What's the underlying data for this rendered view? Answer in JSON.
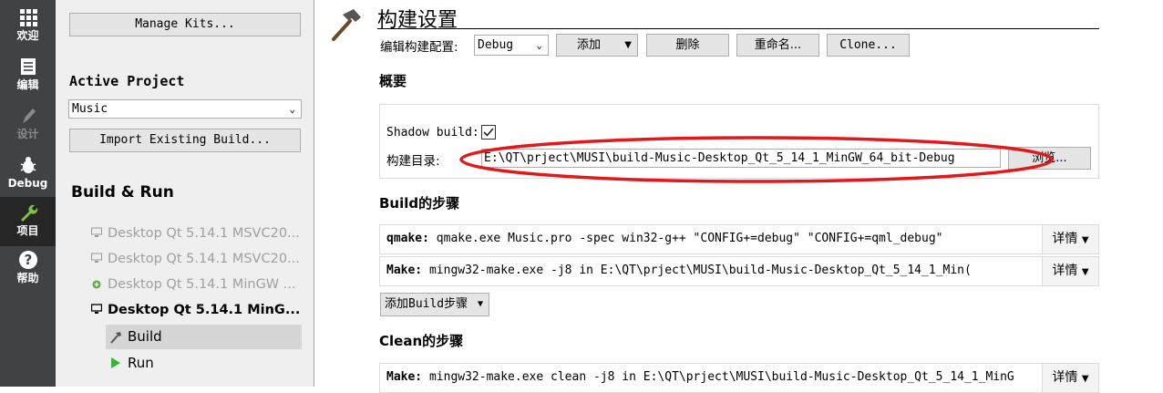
{
  "modebar": {
    "items": [
      {
        "label": "欢迎",
        "icon": "grid-icon"
      },
      {
        "label": "编辑",
        "icon": "edit-icon"
      },
      {
        "label": "设计",
        "icon": "pen-icon"
      },
      {
        "label": "Debug",
        "icon": "bug-icon"
      },
      {
        "label": "项目",
        "icon": "wrench-icon"
      },
      {
        "label": "帮助",
        "icon": "help-icon"
      }
    ]
  },
  "sidebar": {
    "manage_kits": "Manage Kits...",
    "active_project_heading": "Active Project",
    "project_value": "Music",
    "import_build": "Import Existing Build...",
    "build_run_heading": "Build & Run",
    "targets": [
      "Desktop Qt 5.14.1 MSVC20...",
      "Desktop Qt 5.14.1 MSVC20...",
      "Desktop Qt 5.14.1 MinGW ...",
      "Desktop Qt 5.14.1 MinG..."
    ],
    "build_item": "Build",
    "run_item": "Run"
  },
  "main": {
    "title": "构建设置",
    "config_label": "编辑构建配置:",
    "config_value": "Debug",
    "add_button": "添加",
    "delete_button": "删除",
    "rename_button": "重命名...",
    "clone_button": "Clone...",
    "overview_heading": "概要",
    "shadow_label": "Shadow build:",
    "builddir_label": "构建目录:",
    "builddir_value": "E:\\QT\\prject\\MUSI\\build-Music-Desktop_Qt_5_14_1_MinGW_64_bit-Debug",
    "browse_button": "浏览...",
    "build_steps_heading": "Build的步骤",
    "build_steps": [
      {
        "name": "qmake:",
        "command": "qmake.exe Music.pro -spec win32-g++ \"CONFIG+=debug\" \"CONFIG+=qml_debug\"",
        "details": "详情"
      },
      {
        "name": "Make:",
        "command": "mingw32-make.exe -j8 in E:\\QT\\prject\\MUSI\\build-Music-Desktop_Qt_5_14_1_Min(",
        "details": "详情"
      }
    ],
    "add_build_step": "添加Build步骤",
    "clean_steps_heading": "Clean的步骤",
    "clean_steps": [
      {
        "name": "Make:",
        "command": "mingw32-make.exe clean -j8 in E:\\QT\\prject\\MUSI\\build-Music-Desktop_Qt_5_14_1_MinG",
        "details": "详情"
      }
    ]
  },
  "colors": {
    "modebar": "#404244",
    "annotation": "#e0191c",
    "run": "#3bb33b"
  }
}
